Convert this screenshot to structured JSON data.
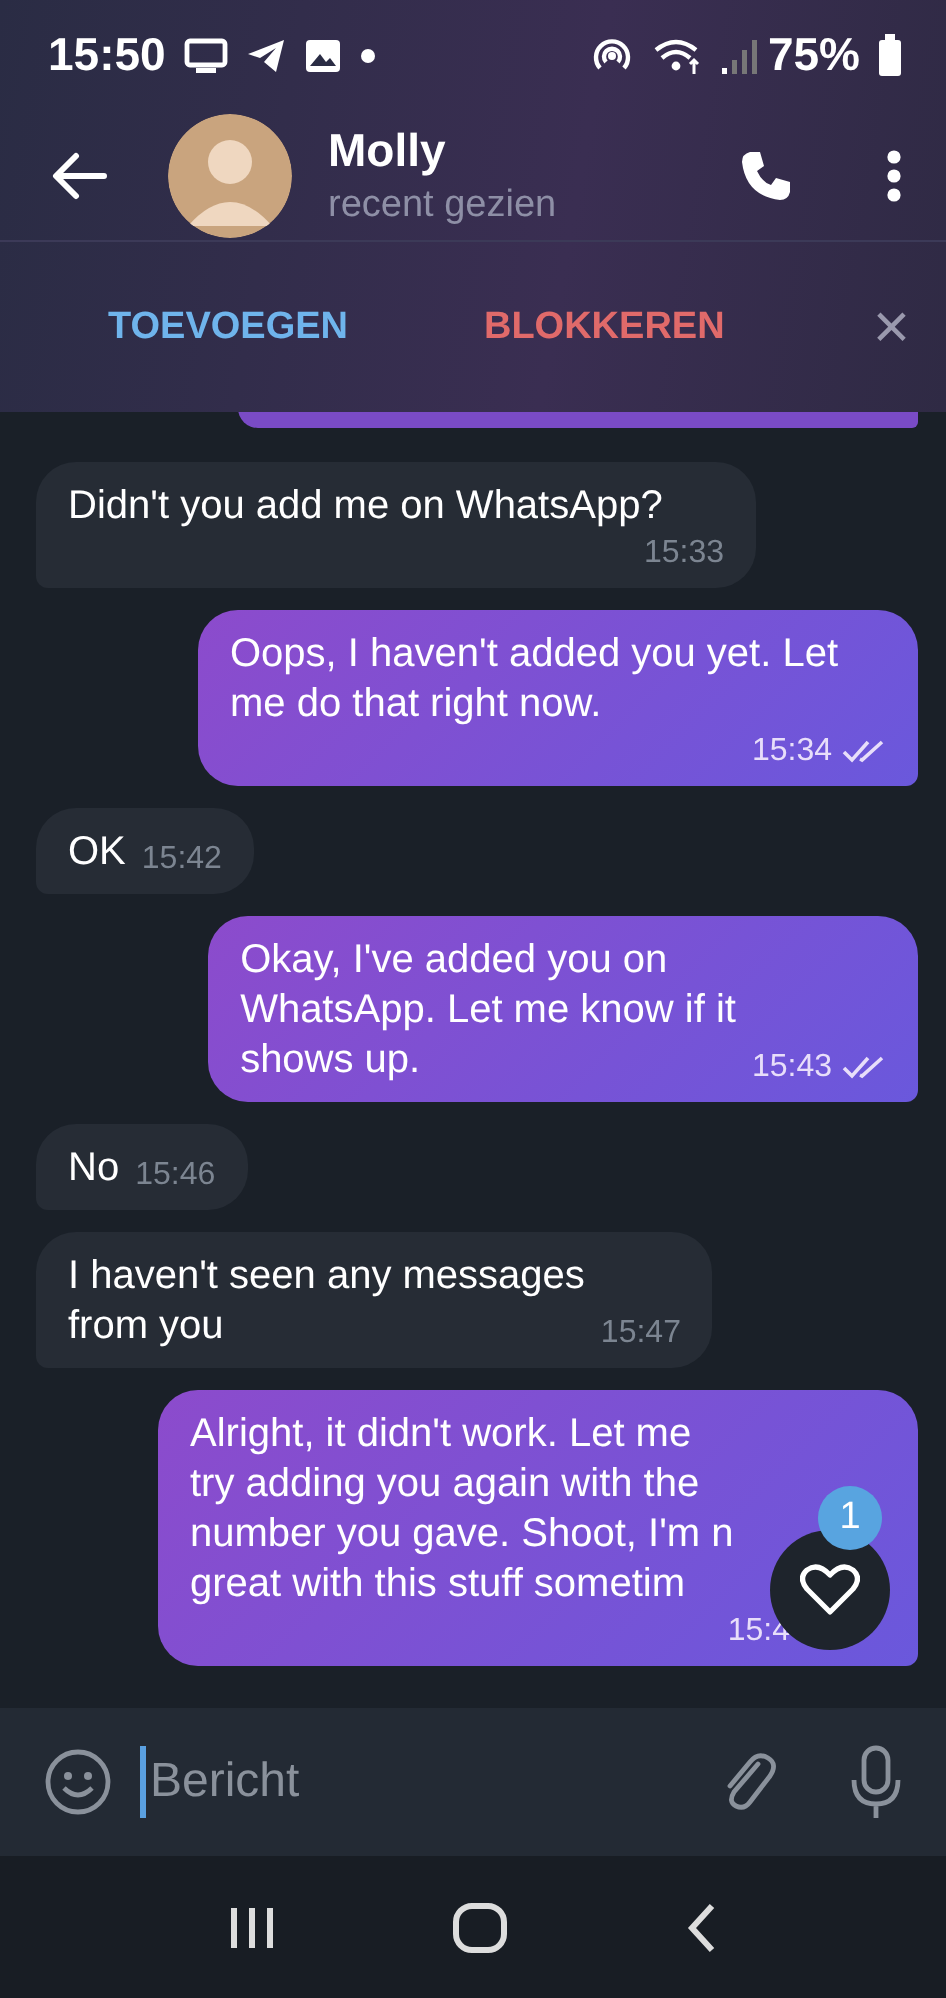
{
  "status_bar": {
    "time": "15:50",
    "battery": "75%"
  },
  "header": {
    "name": "Molly",
    "status": "recent gezien"
  },
  "action_bar": {
    "add": "TOEVOEGEN",
    "block": "BLOKKEREN",
    "close": "×"
  },
  "messages": [
    {
      "kind": "partial"
    },
    {
      "kind": "in",
      "text": "Didn't you add me on WhatsApp?",
      "time": "15:33"
    },
    {
      "kind": "out",
      "text": "Oops, I haven't added you yet. Let\nme do that right now.",
      "time": "15:34",
      "read": true
    },
    {
      "kind": "in",
      "text": "OK",
      "time": "15:42"
    },
    {
      "kind": "out",
      "text": "Okay, I've added you on\nWhatsApp. Let me know if it\nshows up.",
      "time": "15:43",
      "read": true
    },
    {
      "kind": "in",
      "text": "No",
      "time": "15:46"
    },
    {
      "kind": "in",
      "text": "I haven't seen any messages\nfrom you",
      "time": "15:47"
    },
    {
      "kind": "out",
      "text": "Alright, it didn't work. Let me\ntry adding you again with the\nnumber you gave. Shoot, I'm n\ngreat with this stuff sometim",
      "time": "15:4",
      "reaction": {
        "count": "1"
      }
    }
  ],
  "composer": {
    "placeholder": "Bericht"
  }
}
